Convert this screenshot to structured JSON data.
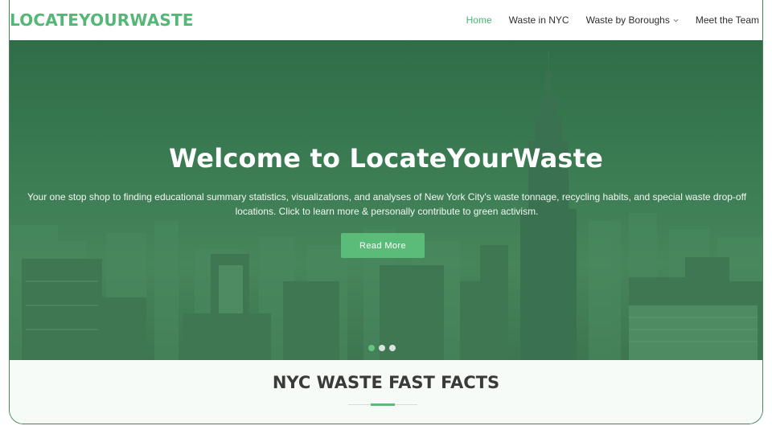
{
  "header": {
    "logo": "LOCATEYOURWASTE",
    "nav": [
      {
        "label": "Home",
        "active": true
      },
      {
        "label": "Waste in NYC",
        "active": false
      },
      {
        "label": "Waste by Boroughs",
        "active": false,
        "dropdown": true
      },
      {
        "label": "Meet the Team",
        "active": false
      }
    ]
  },
  "hero": {
    "title": "Welcome to LocateYourWaste",
    "subtitle": "Your one stop shop to finding educational summary statistics, visualizations, and analyses of New York City's waste tonnage, recycling habits, and special waste drop-off locations. Click to learn more & personally contribute to green activism.",
    "button_label": "Read More",
    "slides": 3,
    "active_slide": 1
  },
  "facts": {
    "title": "NYC WASTE FAST FACTS"
  },
  "colors": {
    "accent": "#5bbb79",
    "overlay": "#3b7c53",
    "active_nav": "#47b475"
  },
  "icons": {
    "dropdown": "chevron-down-icon"
  }
}
